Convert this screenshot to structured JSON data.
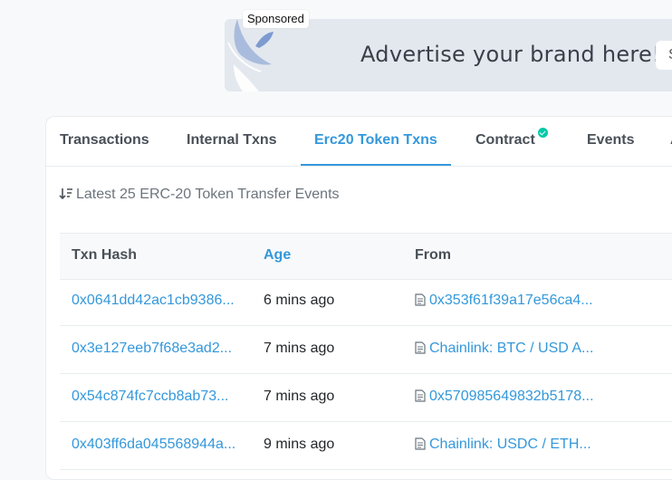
{
  "ad": {
    "sponsored_label": "Sponsored",
    "headline": "Advertise your brand here!",
    "button_text": "S"
  },
  "tabs": [
    {
      "label": "Transactions",
      "active": false
    },
    {
      "label": "Internal Txns",
      "active": false
    },
    {
      "label": "Erc20 Token Txns",
      "active": true
    },
    {
      "label": "Contract",
      "active": false,
      "verified": true
    },
    {
      "label": "Events",
      "active": false
    },
    {
      "label": "A",
      "active": false
    }
  ],
  "summary": "Latest 25 ERC-20 Token Transfer Events",
  "table": {
    "columns": [
      "Txn Hash",
      "Age",
      "From"
    ],
    "rows": [
      {
        "hash": "0x0641dd42ac1cb9386...",
        "age": "6 mins ago",
        "from": "0x353f61f39a17e56ca4..."
      },
      {
        "hash": "0x3e127eeb7f68e3ad2...",
        "age": "7 mins ago",
        "from": "Chainlink: BTC / USD A..."
      },
      {
        "hash": "0x54c874fc7ccb8ab73...",
        "age": "7 mins ago",
        "from": "0x570985649832b5178..."
      },
      {
        "hash": "0x403ff6da045568944a...",
        "age": "9 mins ago",
        "from": "Chainlink: USDC / ETH..."
      }
    ]
  },
  "colors": {
    "accent": "#3498db",
    "verified": "#00c9a7",
    "ad_background": "#e3e8ef"
  }
}
